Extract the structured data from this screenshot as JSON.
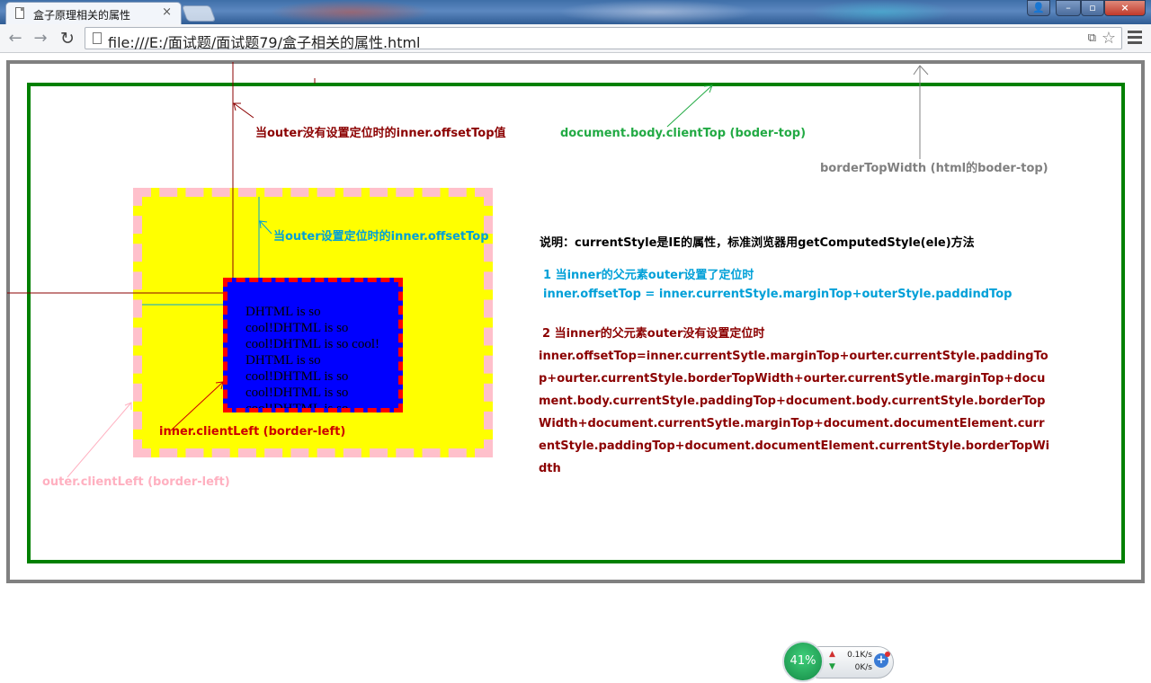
{
  "browser": {
    "tab_title": "盒子原理相关的属性",
    "tab_close": "×",
    "url": "file:///E:/面试题/面试题79/盒子相关的属性.html",
    "window_buttons": {
      "user": "👤",
      "minimize": "–",
      "maximize": "▫",
      "close": "×"
    },
    "nav": {
      "back": "←",
      "forward": "→",
      "reload": "↻",
      "star": "☆",
      "translate": "⧉"
    }
  },
  "page": {
    "inner_text": "DHTML is so cool!DHTML is so cool!DHTML is so cool! DHTML is so cool!DHTML is so cool!DHTML is so cool!DHTML is so",
    "labels": {
      "offset_top_no_position": "当outer没有设置定位时的inner.offsetTop值",
      "body_client_top": "document.body.clientTop (boder-top)",
      "border_top_width": "borderTopWidth (html的boder-top)",
      "offset_top_with_position": "当outer设置定位时的inner.offsetTop",
      "inner_client_left": "inner.clientLeft   (border-left)",
      "outer_client_left": "outer.clientLeft   (border-left)"
    },
    "explanation": {
      "title": "说明：currentStyle是IE的属性，标准浏览器用getComputedStyle(ele)方法",
      "case1_heading": "1 当inner的父元素outer设置了定位时",
      "case1_formula": "inner.offsetTop = inner.currentStyle.marginTop+outerStyle.paddindTop",
      "case2_heading": "2 当inner的父元素outer没有设置定位时",
      "case2_formula": "inner.offsetTop=inner.currentSytle.marginTop+ourter.currentStyle.paddingTop+ourter.currentStyle.borderTopWidth+ourter.currentSytle.marginTop+document.body.currentStyle.paddingTop+document.body.currentStyle.borderTopWidth+document.currentSytle.marginTop+document.documentElement.currentStyle.paddingTop+document.documentElement.currentStyle.borderTopWidth"
    },
    "colors": {
      "html_border": "#808080",
      "body_border": "#008000",
      "outer_bg": "#ffff00",
      "outer_border": "#ffc0cb",
      "inner_bg": "#0000ff",
      "inner_border": "#ff0000"
    }
  },
  "net_widget": {
    "percent": "41%",
    "upload": "0.1K/s",
    "download": "0K/s",
    "plus_icon": "+"
  }
}
